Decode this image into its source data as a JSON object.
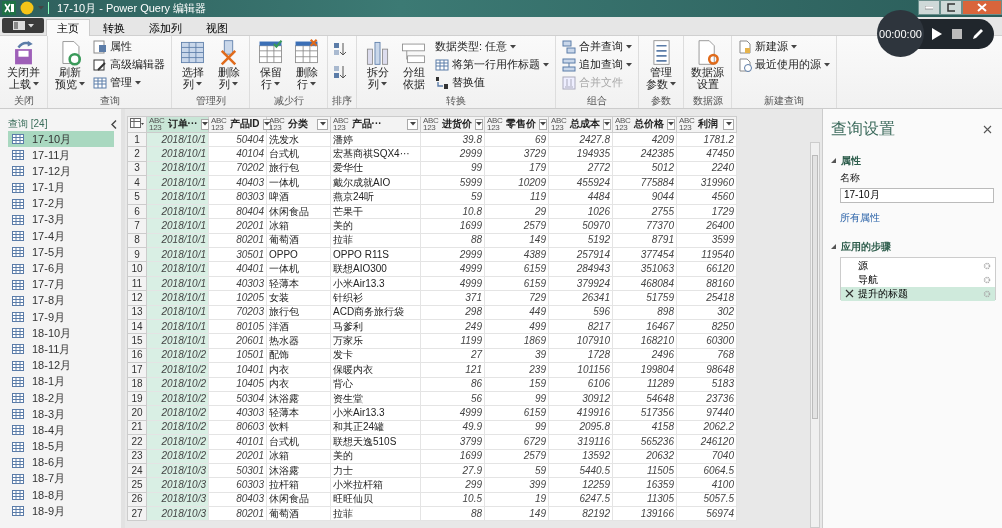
{
  "window": {
    "title": "17-10月 - Power Query 编辑器"
  },
  "recorder": {
    "time": "00:00:00"
  },
  "tabs": [
    {
      "label": "主页",
      "selected": true
    },
    {
      "label": "转换",
      "selected": false
    },
    {
      "label": "添加列",
      "selected": false
    },
    {
      "label": "视图",
      "selected": false
    }
  ],
  "ribbon": {
    "groups": [
      {
        "label": "关闭",
        "buttons": [
          {
            "kind": "large",
            "lines": [
              "关闭并",
              "上载"
            ],
            "dropdown": true
          }
        ]
      },
      {
        "label": "查询",
        "buttons": [
          {
            "kind": "large",
            "lines": [
              "刷新",
              "预览"
            ],
            "dropdown": true
          },
          {
            "kind": "small",
            "label": "属性",
            "dropdown": false
          },
          {
            "kind": "small",
            "label": "高级编辑器",
            "dropdown": false
          },
          {
            "kind": "small",
            "label": "管理",
            "dropdown": true
          }
        ]
      },
      {
        "label": "管理列",
        "buttons": [
          {
            "kind": "large",
            "lines": [
              "选择",
              "列"
            ],
            "dropdown": true
          },
          {
            "kind": "large",
            "lines": [
              "删除",
              "列"
            ],
            "dropdown": true
          }
        ]
      },
      {
        "label": "减少行",
        "buttons": [
          {
            "kind": "large",
            "lines": [
              "保留",
              "行"
            ],
            "dropdown": true
          },
          {
            "kind": "large",
            "lines": [
              "删除",
              "行"
            ],
            "dropdown": true
          }
        ]
      },
      {
        "label": "排序",
        "buttons": [
          {
            "kind": "icon",
            "dropdown": false
          },
          {
            "kind": "icon",
            "dropdown": false
          }
        ]
      },
      {
        "label": "转换",
        "buttons": [
          {
            "kind": "large",
            "lines": [
              "拆分",
              "列"
            ],
            "dropdown": true
          },
          {
            "kind": "large",
            "lines": [
              "分组",
              "依据"
            ],
            "dropdown": false
          },
          {
            "kind": "small",
            "label": "数据类型: 任意",
            "dropdown": true
          },
          {
            "kind": "small",
            "label": "将第一行用作标题",
            "dropdown": true
          },
          {
            "kind": "small",
            "label": "替换值",
            "dropdown": false
          }
        ]
      },
      {
        "label": "组合",
        "buttons": [
          {
            "kind": "small",
            "label": "合并查询",
            "dropdown": true,
            "disabled": false
          },
          {
            "kind": "small",
            "label": "追加查询",
            "dropdown": true,
            "disabled": false
          },
          {
            "kind": "small",
            "label": "合并文件",
            "dropdown": false,
            "disabled": true
          }
        ]
      },
      {
        "label": "参数",
        "buttons": [
          {
            "kind": "large",
            "lines": [
              "管理",
              "参数"
            ],
            "dropdown": true
          }
        ]
      },
      {
        "label": "数据源",
        "buttons": [
          {
            "kind": "large",
            "lines": [
              "数据源",
              "设置"
            ],
            "dropdown": false
          }
        ]
      },
      {
        "label": "新建查询",
        "buttons": [
          {
            "kind": "small",
            "label": "新建源",
            "dropdown": true
          },
          {
            "kind": "small",
            "label": "最近使用的源",
            "dropdown": true
          }
        ]
      }
    ]
  },
  "sidebar": {
    "title": "查询 [24]",
    "items": [
      {
        "label": "17-10月",
        "selected": true
      },
      {
        "label": "17-11月",
        "selected": false
      },
      {
        "label": "17-12月",
        "selected": false
      },
      {
        "label": "17-1月",
        "selected": false
      },
      {
        "label": "17-2月",
        "selected": false
      },
      {
        "label": "17-3月",
        "selected": false
      },
      {
        "label": "17-4月",
        "selected": false
      },
      {
        "label": "17-5月",
        "selected": false
      },
      {
        "label": "17-6月",
        "selected": false
      },
      {
        "label": "17-7月",
        "selected": false
      },
      {
        "label": "17-8月",
        "selected": false
      },
      {
        "label": "17-9月",
        "selected": false
      },
      {
        "label": "18-10月",
        "selected": false
      },
      {
        "label": "18-11月",
        "selected": false
      },
      {
        "label": "18-12月",
        "selected": false
      },
      {
        "label": "18-1月",
        "selected": false
      },
      {
        "label": "18-2月",
        "selected": false
      },
      {
        "label": "18-3月",
        "selected": false
      },
      {
        "label": "18-4月",
        "selected": false
      },
      {
        "label": "18-5月",
        "selected": false
      },
      {
        "label": "18-6月",
        "selected": false
      },
      {
        "label": "18-7月",
        "selected": false
      },
      {
        "label": "18-8月",
        "selected": false
      },
      {
        "label": "18-9月",
        "selected": false
      }
    ]
  },
  "table": {
    "columns": [
      {
        "label": "订单···",
        "type_badge": [
          "ABC",
          "123"
        ],
        "kind": "date",
        "selected": true
      },
      {
        "label": "产品ID",
        "type_badge": [
          "ABC",
          "123"
        ],
        "kind": "number",
        "selected": false
      },
      {
        "label": "分类",
        "type_badge": [
          "ABC",
          "123"
        ],
        "kind": "text",
        "selected": false
      },
      {
        "label": "产品···",
        "type_badge": [
          "ABC",
          "123"
        ],
        "kind": "text",
        "selected": false
      },
      {
        "label": "进货价",
        "type_badge": [
          "ABC",
          "123"
        ],
        "kind": "number",
        "selected": false
      },
      {
        "label": "零售价",
        "type_badge": [
          "ABC",
          "123"
        ],
        "kind": "number",
        "selected": false
      },
      {
        "label": "总成本",
        "type_badge": [
          "ABC",
          "123"
        ],
        "kind": "number",
        "selected": false
      },
      {
        "label": "总价格",
        "type_badge": [
          "ABC",
          "123"
        ],
        "kind": "number",
        "selected": false
      },
      {
        "label": "利润",
        "type_badge": [
          "ABC",
          "123"
        ],
        "kind": "number",
        "selected": false
      }
    ],
    "rows": [
      {
        "n": "1",
        "cells": [
          "2018/10/1",
          "50404",
          "洗发水",
          "潘婷",
          "39.8",
          "69",
          "2427.8",
          "4209",
          "1781.2"
        ]
      },
      {
        "n": "2",
        "cells": [
          "2018/10/1",
          "40104",
          "台式机",
          "宏基商祺SQX4···",
          "2999",
          "3729",
          "194935",
          "242385",
          "47450"
        ]
      },
      {
        "n": "3",
        "cells": [
          "2018/10/1",
          "70202",
          "旅行包",
          "爱华仕",
          "99",
          "179",
          "2772",
          "5012",
          "2240"
        ]
      },
      {
        "n": "4",
        "cells": [
          "2018/10/1",
          "40403",
          "一体机",
          "戴尔成就AIO",
          "5999",
          "10209",
          "455924",
          "775884",
          "319960"
        ]
      },
      {
        "n": "5",
        "cells": [
          "2018/10/1",
          "80303",
          "啤酒",
          "燕京24听",
          "59",
          "119",
          "4484",
          "9044",
          "4560"
        ]
      },
      {
        "n": "6",
        "cells": [
          "2018/10/1",
          "80404",
          "休闲食品",
          "芒果干",
          "10.8",
          "29",
          "1026",
          "2755",
          "1729"
        ]
      },
      {
        "n": "7",
        "cells": [
          "2018/10/1",
          "20201",
          "冰箱",
          "美的",
          "1699",
          "2579",
          "50970",
          "77370",
          "26400"
        ]
      },
      {
        "n": "8",
        "cells": [
          "2018/10/1",
          "80201",
          "葡萄酒",
          "拉菲",
          "88",
          "149",
          "5192",
          "8791",
          "3599"
        ]
      },
      {
        "n": "9",
        "cells": [
          "2018/10/1",
          "30501",
          "OPPO",
          "OPPO R11S",
          "2999",
          "4389",
          "257914",
          "377454",
          "119540"
        ]
      },
      {
        "n": "10",
        "cells": [
          "2018/10/1",
          "40401",
          "一体机",
          "联想AIO300",
          "4999",
          "6159",
          "284943",
          "351063",
          "66120"
        ]
      },
      {
        "n": "11",
        "cells": [
          "2018/10/1",
          "40303",
          "轻薄本",
          "小米Air13.3",
          "4999",
          "6159",
          "379924",
          "468084",
          "88160"
        ]
      },
      {
        "n": "12",
        "cells": [
          "2018/10/1",
          "10205",
          "女装",
          "针织衫",
          "371",
          "729",
          "26341",
          "51759",
          "25418"
        ]
      },
      {
        "n": "13",
        "cells": [
          "2018/10/1",
          "70203",
          "旅行包",
          "ACD商务旅行袋",
          "298",
          "449",
          "596",
          "898",
          "302"
        ]
      },
      {
        "n": "14",
        "cells": [
          "2018/10/1",
          "80105",
          "洋酒",
          "马爹利",
          "249",
          "499",
          "8217",
          "16467",
          "8250"
        ]
      },
      {
        "n": "15",
        "cells": [
          "2018/10/1",
          "20601",
          "热水器",
          "万家乐",
          "1199",
          "1869",
          "107910",
          "168210",
          "60300"
        ]
      },
      {
        "n": "16",
        "cells": [
          "2018/10/2",
          "10501",
          "配饰",
          "发卡",
          "27",
          "39",
          "1728",
          "2496",
          "768"
        ]
      },
      {
        "n": "17",
        "cells": [
          "2018/10/2",
          "10401",
          "内衣",
          "保暖内衣",
          "121",
          "239",
          "101156",
          "199804",
          "98648"
        ]
      },
      {
        "n": "18",
        "cells": [
          "2018/10/2",
          "10405",
          "内衣",
          "背心",
          "86",
          "159",
          "6106",
          "11289",
          "5183"
        ]
      },
      {
        "n": "19",
        "cells": [
          "2018/10/2",
          "50304",
          "沐浴露",
          "资生堂",
          "56",
          "99",
          "30912",
          "54648",
          "23736"
        ]
      },
      {
        "n": "20",
        "cells": [
          "2018/10/2",
          "40303",
          "轻薄本",
          "小米Air13.3",
          "4999",
          "6159",
          "419916",
          "517356",
          "97440"
        ]
      },
      {
        "n": "21",
        "cells": [
          "2018/10/2",
          "80603",
          "饮料",
          "和其正24罐",
          "49.9",
          "99",
          "2095.8",
          "4158",
          "2062.2"
        ]
      },
      {
        "n": "22",
        "cells": [
          "2018/10/2",
          "40101",
          "台式机",
          "联想天逸510S",
          "3799",
          "6729",
          "319116",
          "565236",
          "246120"
        ]
      },
      {
        "n": "23",
        "cells": [
          "2018/10/2",
          "20201",
          "冰箱",
          "美的",
          "1699",
          "2579",
          "13592",
          "20632",
          "7040"
        ]
      },
      {
        "n": "24",
        "cells": [
          "2018/10/3",
          "50301",
          "沐浴露",
          "力士",
          "27.9",
          "59",
          "5440.5",
          "11505",
          "6064.5"
        ]
      },
      {
        "n": "25",
        "cells": [
          "2018/10/3",
          "60303",
          "拉杆箱",
          "小米拉杆箱",
          "299",
          "399",
          "12259",
          "16359",
          "4100"
        ]
      },
      {
        "n": "26",
        "cells": [
          "2018/10/3",
          "80403",
          "休闲食品",
          "旺旺仙贝",
          "10.5",
          "19",
          "6247.5",
          "11305",
          "5057.5"
        ]
      },
      {
        "n": "27",
        "cells": [
          "2018/10/3",
          "80201",
          "葡萄酒",
          "拉菲",
          "88",
          "149",
          "82192",
          "139166",
          "56974"
        ]
      }
    ]
  },
  "settings": {
    "title": "查询设置",
    "sections": [
      {
        "title": "属性",
        "expanded": true,
        "kind": "properties",
        "name_label": "名称",
        "name_value": "17-10月",
        "link": "所有属性"
      },
      {
        "title": "应用的步骤",
        "expanded": true,
        "kind": "steps",
        "steps": [
          {
            "label": "源",
            "selected": false
          },
          {
            "label": "导航",
            "selected": false
          },
          {
            "label": "提升的标题",
            "selected": true
          }
        ]
      }
    ]
  }
}
